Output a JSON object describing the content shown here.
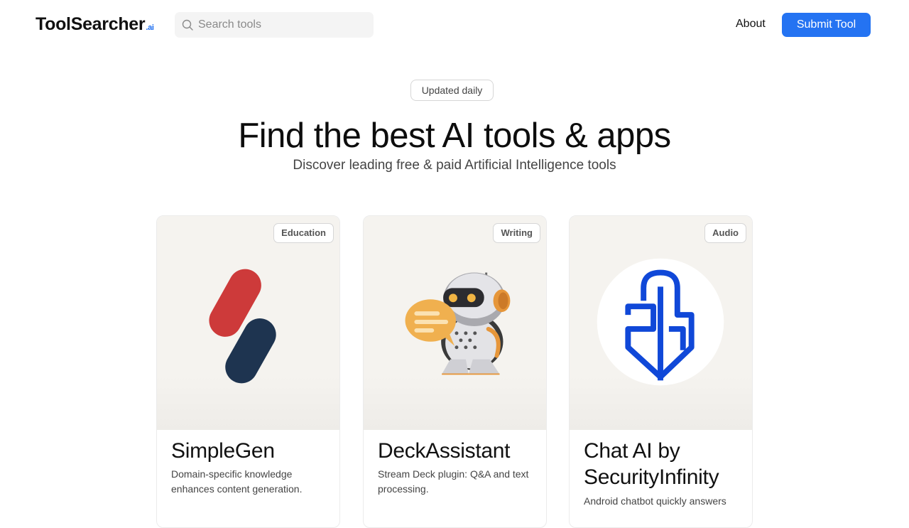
{
  "header": {
    "logo_main": "ToolSearcher",
    "logo_suffix": ".ai",
    "search_placeholder": "Search tools",
    "about_label": "About",
    "submit_label": "Submit Tool"
  },
  "hero": {
    "badge": "Updated daily",
    "headline": "Find the best AI tools & apps",
    "subheadline": "Discover leading free & paid Artificial Intelligence tools"
  },
  "cards": [
    {
      "category": "Education",
      "name": "SimpleGen",
      "description": "Domain-specific knowledge enhances content generation.",
      "icon": "simplegen-logo-icon"
    },
    {
      "category": "Writing",
      "name": "DeckAssistant",
      "description": "Stream Deck plugin: Q&A and text processing.",
      "icon": "robot-chat-icon"
    },
    {
      "category": "Audio",
      "name": "Chat AI by SecurityInfinity",
      "description": "Android chatbot quickly answers",
      "icon": "securityinfinity-logo-icon"
    }
  ],
  "colors": {
    "accent": "#2473f2",
    "logo_suffix": "#1d6ef0",
    "card_background": "#f5f3ef"
  }
}
